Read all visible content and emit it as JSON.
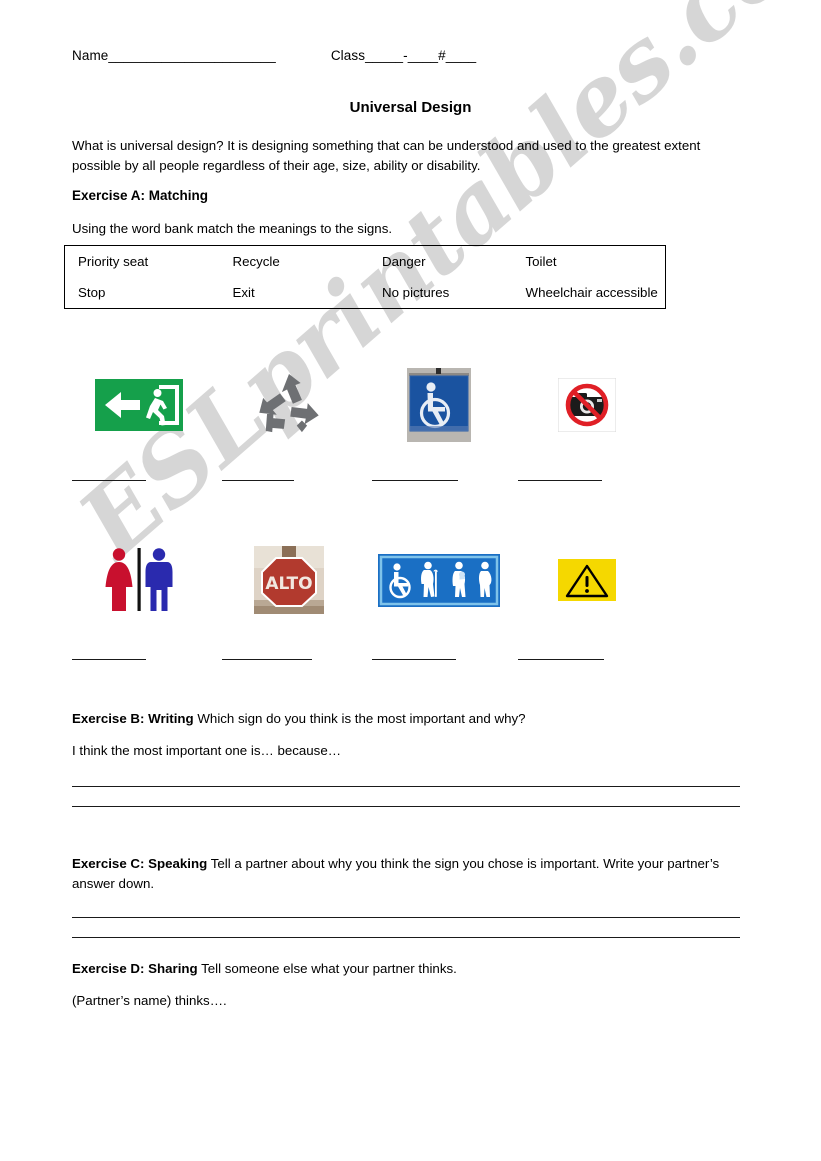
{
  "header": {
    "name_label": "Name",
    "name_blank": "______________________",
    "class_label": "Class",
    "class_blank_1": "_____",
    "class_dash": "-",
    "class_blank_2": "____",
    "hash": "#",
    "class_blank_3": "____"
  },
  "title": "Universal Design",
  "intro": "What is universal design? It is designing something that can be understood and used to the greatest extent possible by all people regardless of their age, size, ability or disability.",
  "exercise_a": {
    "title": "Exercise A: Matching",
    "instruction": "Using the word bank match the meanings to the signs.",
    "word_bank": {
      "rows": [
        [
          "Priority seat",
          "Recycle",
          "Danger",
          "Toilet"
        ],
        [
          "Stop",
          "Exit",
          "No pictures",
          "Wheelchair accessible"
        ]
      ]
    },
    "signs": [
      {
        "name": "exit-sign",
        "meaning": "Exit",
        "colors": {
          "background": "#15A04B",
          "figure": "#ffffff"
        }
      },
      {
        "name": "recycle-sign",
        "meaning": "Recycle",
        "colors": {
          "arrows": "#6e7073"
        }
      },
      {
        "name": "wheelchair-accessible-sign",
        "meaning": "Wheelchair accessible",
        "colors": {
          "background": "#1A53A0",
          "figure": "#e8eef5"
        }
      },
      {
        "name": "no-pictures-sign",
        "meaning": "No pictures",
        "colors": {
          "prohibition": "#E01F26",
          "camera": "#1b1b1b"
        }
      },
      {
        "name": "toilet-sign",
        "meaning": "Toilet",
        "colors": {
          "female": "#C8102E",
          "male": "#2A2AAE"
        }
      },
      {
        "name": "stop-sign",
        "meaning": "Stop",
        "text": "ALTO",
        "colors": {
          "octagon": "#B23A2E",
          "background": "#ded3c6"
        }
      },
      {
        "name": "priority-seat-sign",
        "meaning": "Priority seat",
        "colors": {
          "background": "#1A6FC4",
          "figure": "#ffffff",
          "border": "#7FC3EA"
        }
      },
      {
        "name": "danger-sign",
        "meaning": "Danger",
        "colors": {
          "background": "#F5D800",
          "triangle": "#000000"
        }
      }
    ],
    "answer_blanks": [
      "",
      "",
      "",
      "",
      "",
      "",
      "",
      ""
    ]
  },
  "exercise_b": {
    "label": "Exercise B: Writing",
    "prompt": " Which sign do you think is the most important and why?",
    "starter": "I think the most important one is… because…",
    "answer_lines": [
      "",
      ""
    ]
  },
  "exercise_c": {
    "label": "Exercise C: Speaking",
    "prompt": " Tell a partner about why you think the sign you chose is important. Write your partner’s answer down.",
    "answer_lines": [
      "",
      ""
    ]
  },
  "exercise_d": {
    "label": "Exercise D: Sharing",
    "prompt": " Tell someone else what your partner thinks.",
    "starter": "(Partner’s name) thinks…."
  },
  "watermark": {
    "text": "ESLprintables.com",
    "color": "#c9c9c9"
  }
}
